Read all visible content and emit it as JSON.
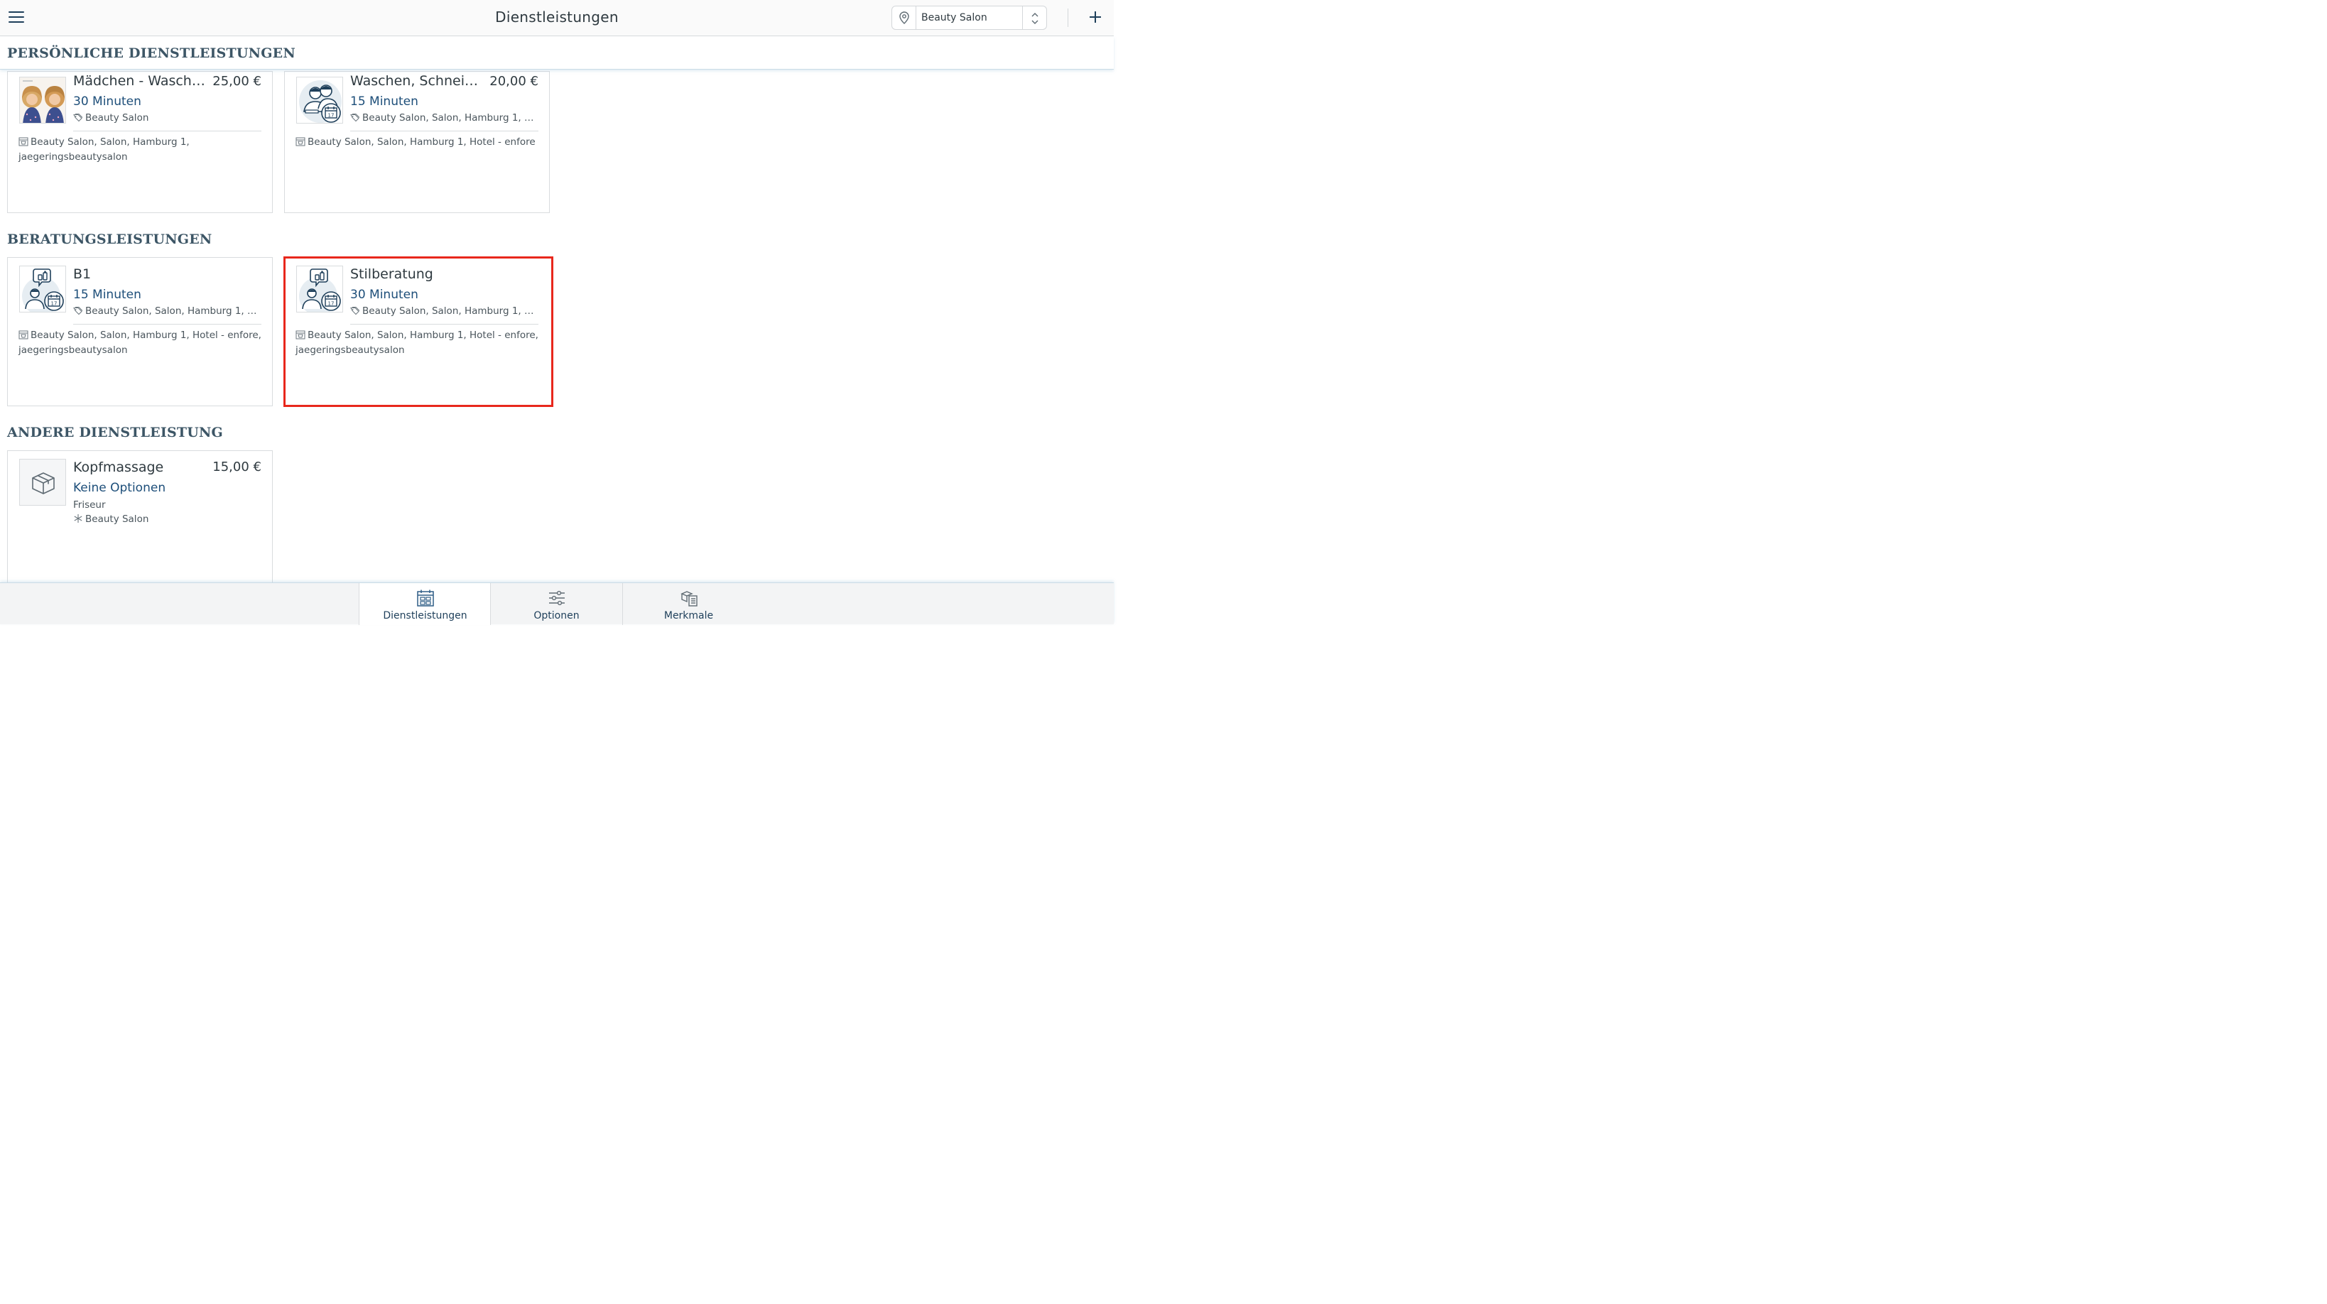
{
  "header": {
    "title": "Dienstleistungen",
    "location_selector": {
      "value": "Beauty Salon"
    },
    "icons": {
      "menu": "hamburger-menu-icon",
      "location": "map-pin-icon",
      "chevron": "up-down-chevron-icon",
      "add": "plus-icon"
    }
  },
  "sections": [
    {
      "title": "PERSÖNLICHE DIENSTLEISTUNGEN",
      "items": [
        {
          "name": "Mädchen - Wasche...",
          "price": "25,00 €",
          "duration": "30 Minuten",
          "tagline": "Beauty Salon",
          "locations": "Beauty Salon, Salon, Hamburg 1, jaegeringsbeautysalon",
          "thumbnail": "girls-haircut-photo"
        },
        {
          "name": "Waschen, Schneid...",
          "price": "20,00 €",
          "duration": "15 Minuten",
          "tagline": "Beauty Salon, Salon, Hamburg 1, Hot...",
          "locations": "Beauty Salon, Salon, Hamburg 1, Hotel - enfore",
          "thumbnail": "two-persons-calendar-icon"
        }
      ]
    },
    {
      "title": "BERATUNGSLEISTUNGEN",
      "items": [
        {
          "name": "B1",
          "price": "",
          "duration": "15 Minuten",
          "tagline": "Beauty Salon, Salon, Hamburg 1, Hot...",
          "locations": "Beauty Salon, Salon, Hamburg 1, Hotel - enfore, jaegeringsbeautysalon",
          "thumbnail": "consultation-calendar-icon"
        },
        {
          "name": "Stilberatung",
          "price": "",
          "duration": "30 Minuten",
          "tagline": "Beauty Salon, Salon, Hamburg 1, Hot...",
          "locations": "Beauty Salon, Salon, Hamburg 1, Hotel - enfore, jaegeringsbeautysalon",
          "thumbnail": "consultation-calendar-icon",
          "highlighted": true
        }
      ]
    },
    {
      "title": "ANDERE DIENSTLEISTUNG",
      "items": [
        {
          "name": "Kopfmassage",
          "price": "15,00 €",
          "duration": "Keine Optionen",
          "category": "Friseur",
          "tagline": "Beauty Salon",
          "thumbnail": "box-icon"
        }
      ]
    }
  ],
  "tabs": [
    {
      "label": "Dienstleistungen",
      "icon": "services-grid-icon",
      "active": true
    },
    {
      "label": "Optionen",
      "icon": "sliders-icon",
      "active": false
    },
    {
      "label": "Merkmale",
      "icon": "features-icon",
      "active": false
    }
  ],
  "colors": {
    "accent": "#1d4e79",
    "section_title": "#3d5666",
    "highlight_border": "#e8271c",
    "card_border": "#d9dcde"
  }
}
